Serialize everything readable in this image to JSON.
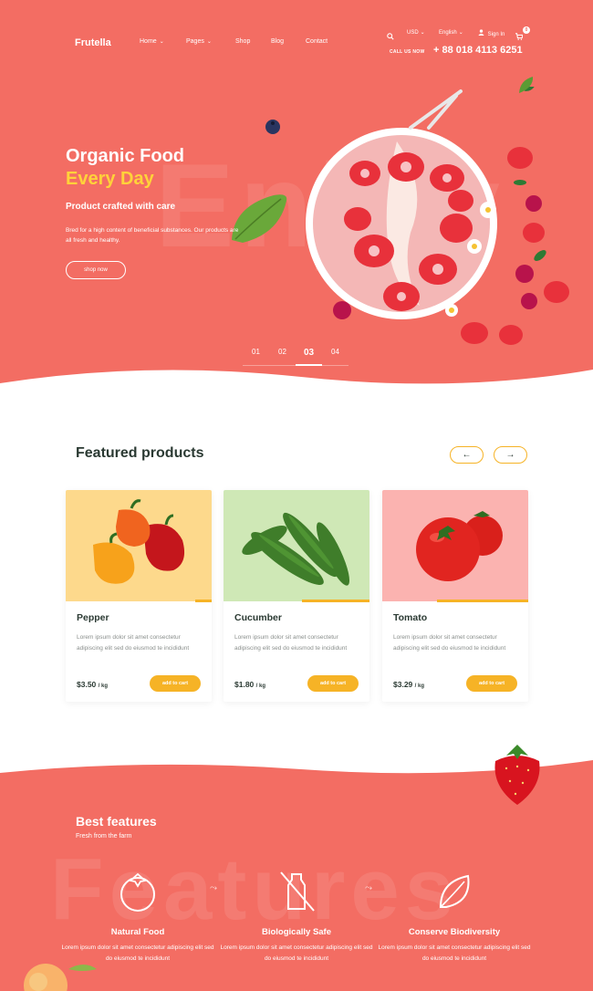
{
  "header": {
    "logo": "Frutella",
    "nav": [
      {
        "label": "Home",
        "dropdown": true
      },
      {
        "label": "Pages",
        "dropdown": true
      },
      {
        "label": "Shop",
        "dropdown": false
      },
      {
        "label": "Blog",
        "dropdown": false
      },
      {
        "label": "Contact",
        "dropdown": false
      }
    ],
    "currency": "USD",
    "language": "English",
    "sign_in": "Sign In",
    "cart_count": "0",
    "call_label": "CALL US NOW",
    "phone": "+ 88 018 4113 6251"
  },
  "hero": {
    "background_word": "Enjoy",
    "title_line1": "Organic Food",
    "title_line2": "Every Day",
    "subtitle": "Product crafted with care",
    "description": "Bred for a high content of beneficial substances. Our products are all fresh and healthy.",
    "button": "shop now",
    "slides": [
      "01",
      "02",
      "03",
      "04"
    ],
    "active_slide": 2
  },
  "featured": {
    "title": "Featured products",
    "prev_icon": "arrow-left-icon",
    "next_icon": "arrow-right-icon",
    "products": [
      {
        "name": "Pepper",
        "desc": "Lorem ipsum dolor sit amet consectetur adipiscing elit sed do eiusmod te incididunt",
        "price": "$3.50",
        "unit": "/ kg",
        "button": "add to cart",
        "bg": "#fdd98c"
      },
      {
        "name": "Cucumber",
        "desc": "Lorem ipsum dolor sit amet consectetur adipiscing elit sed do eiusmod te incididunt",
        "price": "$1.80",
        "unit": "/ kg",
        "button": "add to cart",
        "bg": "#cfe8b6"
      },
      {
        "name": "Tomato",
        "desc": "Lorem ipsum dolor sit amet consectetur adipiscing elit sed do eiusmod te incididunt",
        "price": "$3.29",
        "unit": "/ kg",
        "button": "add to cart",
        "bg": "#fbb3b0"
      }
    ]
  },
  "features": {
    "background_word": "Features",
    "title": "Best features",
    "subtitle": "Fresh from the farm",
    "items": [
      {
        "title": "Natural Food",
        "desc": "Lorem ipsum dolor sit amet consectetur adipiscing elit sed do eiusmod te incididunt",
        "icon": "tomato-icon"
      },
      {
        "title": "Biologically Safe",
        "desc": "Lorem ipsum dolor sit amet consectetur adipiscing elit sed do eiusmod te incididunt",
        "icon": "no-bottle-icon"
      },
      {
        "title": "Conserve Biodiversity",
        "desc": "Lorem ipsum dolor sit amet consectetur adipiscing elit sed do eiusmod te incididunt",
        "icon": "leaf-icon"
      }
    ]
  },
  "colors": {
    "primary": "#f36d63",
    "accent": "#ffd23a",
    "button": "#f6b326",
    "dark_text": "#2b3a33"
  }
}
